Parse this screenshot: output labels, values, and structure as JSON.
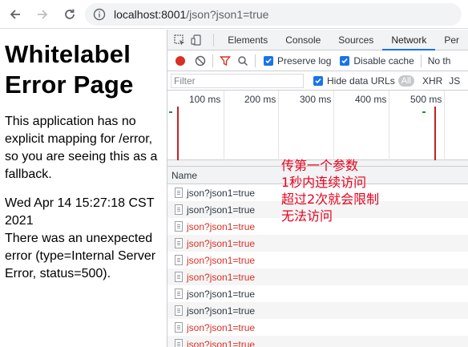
{
  "browser": {
    "url_host": "localhost:8001",
    "url_path": "/json?json1=true"
  },
  "page": {
    "title": "Whitelabel Error Page",
    "description": "This application has no explicit mapping for /error, so you are seeing this as a fallback.",
    "timestamp": "Wed Apr 14 15:27:18 CST 2021",
    "error_text": "There was an unexpected error (type=Internal Server Error, status=500)."
  },
  "devtools": {
    "tabs": [
      "Elements",
      "Console",
      "Sources",
      "Network",
      "Per"
    ],
    "active_tab": "Network",
    "toolbar": {
      "preserve_log": "Preserve log",
      "disable_cache": "Disable cache",
      "throttle": "No th"
    },
    "filter": {
      "placeholder": "Filter",
      "hide_data_urls": "Hide data URLs",
      "all": "All",
      "xhr": "XHR",
      "js": "JS"
    },
    "timeline_ticks": [
      "100 ms",
      "200 ms",
      "300 ms",
      "400 ms",
      "500 ms"
    ],
    "column_name": "Name",
    "requests": [
      {
        "name": "json?json1=true",
        "status": "ok"
      },
      {
        "name": "json?json1=true",
        "status": "ok"
      },
      {
        "name": "json?json1=true",
        "status": "error"
      },
      {
        "name": "json?json1=true",
        "status": "error"
      },
      {
        "name": "json?json1=true",
        "status": "error"
      },
      {
        "name": "json?json1=true",
        "status": "error"
      },
      {
        "name": "json?json1=true",
        "status": "ok"
      },
      {
        "name": "json?json1=true",
        "status": "ok"
      },
      {
        "name": "json?json1=true",
        "status": "error"
      },
      {
        "name": "json?json1=true",
        "status": "error"
      }
    ]
  },
  "annotation": {
    "lines": [
      "传第一个参数",
      "1秒内连续访问",
      "超过2次就会限制",
      "无法访问"
    ]
  },
  "colors": {
    "error_red": "#d93025",
    "annotation_red": "#e8001c",
    "accent_blue": "#1a73e8"
  }
}
